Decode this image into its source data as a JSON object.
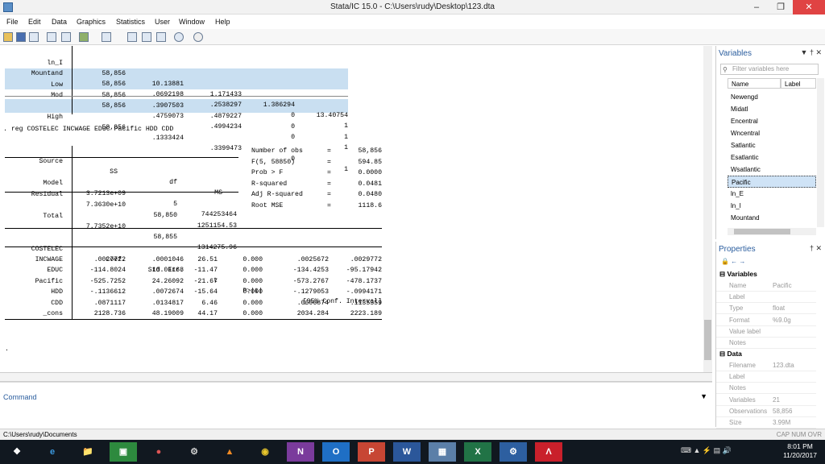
{
  "window": {
    "title": "Stata/IC 15.0 - C:\\Users\\rudy\\Desktop\\123.dta"
  },
  "menu": [
    "File",
    "Edit",
    "Data",
    "Graphics",
    "Statistics",
    "User",
    "Window",
    "Help"
  ],
  "summary_rows": [
    {
      "name": "ln_I",
      "obs": "58,856",
      "mean": "10.13881",
      "sd": "1.171433",
      "min": "1.386294",
      "max": "13.40754"
    },
    {
      "name": "Mountand",
      "obs": "58,856",
      "mean": ".0692198",
      "sd": ".2538297",
      "min": "0",
      "max": "1"
    },
    {
      "name": "Low",
      "obs": "58,856",
      "mean": ".3907503",
      "sd": ".4879227",
      "min": "0",
      "max": "1"
    },
    {
      "name": "Mod",
      "obs": "58,856",
      "mean": ".4759073",
      "sd": ".4994234",
      "min": "0",
      "max": "1"
    },
    {
      "name": "High",
      "obs": "58,856",
      "mean": ".1333424",
      "sd": ".3399473",
      "min": "0",
      "max": "1"
    }
  ],
  "command_echo": ". reg COSTELEC INCWAGE EDUC Pacific HDD CDD",
  "anova": {
    "headers": [
      "Source",
      "SS",
      "df",
      "MS"
    ],
    "rows": [
      {
        "source": "Model",
        "ss": "3.7213e+09",
        "df": "5",
        "ms": "744253464"
      },
      {
        "source": "Residual",
        "ss": "7.3630e+10",
        "df": "58,850",
        "ms": "1251154.53"
      },
      {
        "source": "Total",
        "ss": "7.7352e+10",
        "df": "58,855",
        "ms": "1314275.96"
      }
    ]
  },
  "fit_stats": [
    {
      "label": "Number of obs",
      "eq": "=",
      "value": "58,856"
    },
    {
      "label": "F(5, 58850)",
      "eq": "=",
      "value": "594.85"
    },
    {
      "label": "Prob > F",
      "eq": "=",
      "value": "0.0000"
    },
    {
      "label": "R-squared",
      "eq": "=",
      "value": "0.0481"
    },
    {
      "label": "Adj R-squared",
      "eq": "=",
      "value": "0.0480"
    },
    {
      "label": "Root MSE",
      "eq": "=",
      "value": "1118.6"
    }
  ],
  "coef": {
    "depvar": "COSTELEC",
    "headers": [
      "Coef.",
      "Std. Err.",
      "t",
      "P>|t|",
      "[95% Conf. Interval]"
    ],
    "rows": [
      {
        "name": "INCWAGE",
        "coef": ".0027722",
        "se": ".0001046",
        "t": "26.51",
        "p": "0.000",
        "lo": ".0025672",
        "hi": ".0029772"
      },
      {
        "name": "EDUC",
        "coef": "-114.8024",
        "se": "10.01168",
        "t": "-11.47",
        "p": "0.000",
        "lo": "-134.4253",
        "hi": "-95.17942"
      },
      {
        "name": "Pacific",
        "coef": "-525.7252",
        "se": "24.26092",
        "t": "-21.67",
        "p": "0.000",
        "lo": "-573.2767",
        "hi": "-478.1737"
      },
      {
        "name": "HDD",
        "coef": "-.1136612",
        "se": ".0072674",
        "t": "-15.64",
        "p": "0.000",
        "lo": "-.1279053",
        "hi": "-.0994171"
      },
      {
        "name": "CDD",
        "coef": ".0871117",
        "se": ".0134817",
        "t": "6.46",
        "p": "0.000",
        "lo": ".0606874",
        "hi": ".1135359"
      },
      {
        "name": "_cons",
        "coef": "2128.736",
        "se": "48.19009",
        "t": "44.17",
        "p": "0.000",
        "lo": "2034.284",
        "hi": "2223.189"
      }
    ]
  },
  "prompt_dot": ".",
  "command_label": "Command",
  "status": {
    "path": "C:\\Users\\rudy\\Documents",
    "flags": "CAP  NUM  OVR"
  },
  "variables": {
    "title": "Variables",
    "filter_placeholder": "Filter variables here",
    "col_name": "Name",
    "col_label": "Label",
    "items": [
      "Newengd",
      "Midatl",
      "Encentral",
      "Wncentral",
      "Satlantic",
      "Esatlantic",
      "Wsatlantic",
      "Pacific",
      "ln_E",
      "ln_I",
      "Mountand"
    ],
    "selected": "Pacific"
  },
  "properties": {
    "title": "Properties",
    "sec_variables": "Variables",
    "var_rows": [
      {
        "k": "Name",
        "v": "Pacific"
      },
      {
        "k": "Label",
        "v": ""
      },
      {
        "k": "Type",
        "v": "float"
      },
      {
        "k": "Format",
        "v": "%9.0g"
      },
      {
        "k": "Value label",
        "v": ""
      },
      {
        "k": "Notes",
        "v": ""
      }
    ],
    "sec_data": "Data",
    "data_rows": [
      {
        "k": "Filename",
        "v": "123.dta"
      },
      {
        "k": "Label",
        "v": ""
      },
      {
        "k": "Notes",
        "v": ""
      },
      {
        "k": "Variables",
        "v": "21"
      },
      {
        "k": "Observations",
        "v": "58,856"
      },
      {
        "k": "Size",
        "v": "3.99M"
      }
    ]
  },
  "clock": {
    "time": "8:01 PM",
    "date": "11/20/2017"
  },
  "colors": {
    "accent": "#2a5d9e",
    "highlight": "#c9dff1",
    "close": "#e04343"
  }
}
